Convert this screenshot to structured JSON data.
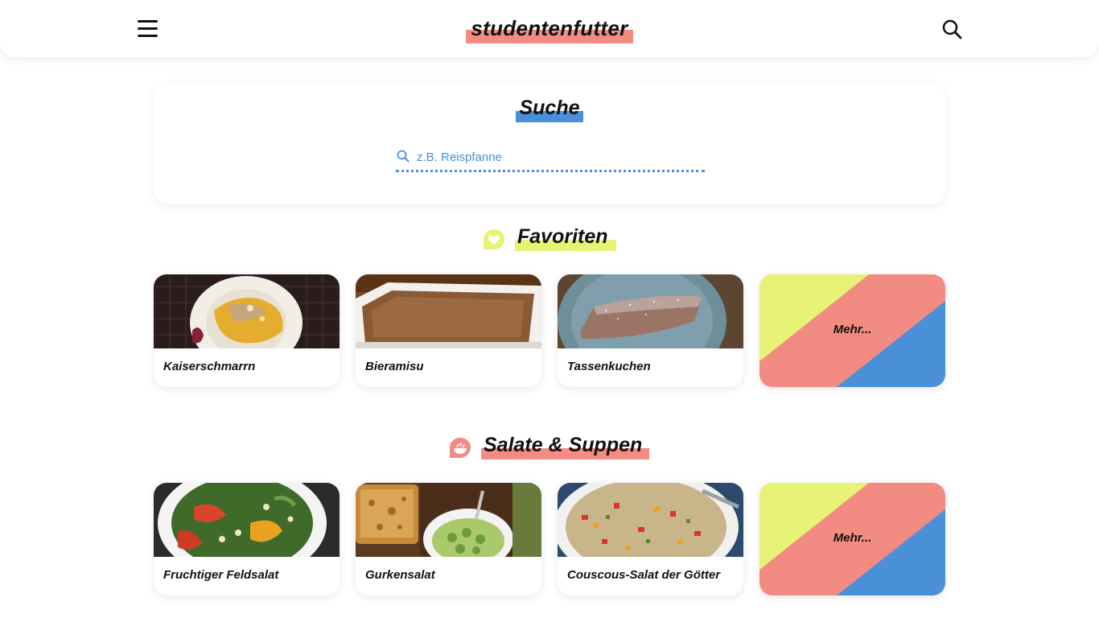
{
  "header": {
    "logo": "studentenfutter",
    "menu_icon": "hamburger-menu-icon",
    "search_icon": "search-icon"
  },
  "search": {
    "title": "Suche",
    "placeholder": "z.B. Reispfanne",
    "value": ""
  },
  "colors": {
    "accent_red": "#f28b82",
    "accent_blue": "#4a90d9",
    "accent_yellow": "#e8f277"
  },
  "sections": [
    {
      "title": "Favoriten",
      "icon": "heart-icon",
      "cards": [
        "Kaiserschmarrn",
        "Bieramisu",
        "Tassenkuchen"
      ],
      "more_label": "Mehr..."
    },
    {
      "title": "Salate & Suppen",
      "icon": "salad-bowl-icon",
      "cards": [
        "Fruchtiger Feldsalat",
        "Gurkensalat",
        "Couscous-Salat der Götter"
      ],
      "more_label": "Mehr..."
    }
  ]
}
